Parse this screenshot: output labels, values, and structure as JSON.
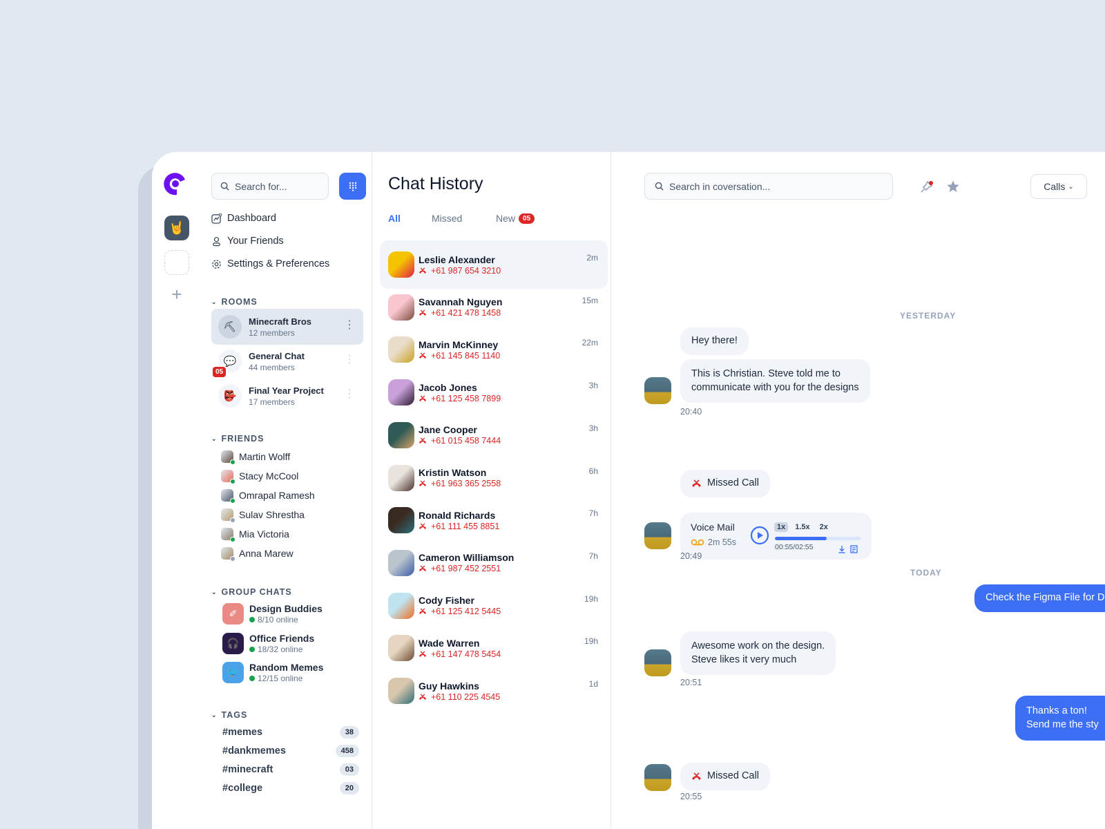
{
  "rail": {
    "emoji": "🤘",
    "add_label": "+"
  },
  "nav": {
    "search_placeholder": "Search for...",
    "menu": [
      {
        "label": "Dashboard",
        "icon": "dashboard-icon"
      },
      {
        "label": "Your Friends",
        "icon": "user-icon"
      },
      {
        "label": "Settings & Preferences",
        "icon": "gear-icon"
      }
    ],
    "rooms_title": "ROOMS",
    "rooms": [
      {
        "name": "Minecraft Bros",
        "members": "12 members",
        "icon": "⛏",
        "active": true
      },
      {
        "name": "General Chat",
        "members": "44 members",
        "icon": "💬",
        "badge": "05"
      },
      {
        "name": "Final Year Project",
        "members": "17 members",
        "icon": "👺"
      }
    ],
    "friends_title": "FRIENDS",
    "friends": [
      {
        "name": "Martin Wolff",
        "status": "online"
      },
      {
        "name": "Stacy McCool",
        "status": "online"
      },
      {
        "name": "Omrapal Ramesh",
        "status": "online"
      },
      {
        "name": "Sulav Shrestha",
        "status": "offline"
      },
      {
        "name": "Mia Victoria",
        "status": "online"
      },
      {
        "name": "Anna Marew",
        "status": "offline"
      }
    ],
    "groups_title": "GROUP CHATS",
    "groups": [
      {
        "name": "Design Buddies",
        "online": "8/10 online",
        "color": "#ea8a85",
        "icon": "brush-icon"
      },
      {
        "name": "Office Friends",
        "online": "18/32 online",
        "color": "#2a1c4a",
        "icon": "headphones-icon"
      },
      {
        "name": "Random Memes",
        "online": "12/15 online",
        "color": "#4aa3e8",
        "icon": "bird-icon"
      }
    ],
    "tags_title": "TAGS",
    "tags": [
      {
        "name": "#memes",
        "count": "38"
      },
      {
        "name": "#dankmemes",
        "count": "458"
      },
      {
        "name": "#minecraft",
        "count": "03"
      },
      {
        "name": "#college",
        "count": "20"
      }
    ]
  },
  "history": {
    "title": "Chat History",
    "tabs": [
      {
        "label": "All",
        "active": true
      },
      {
        "label": "Missed"
      },
      {
        "label": "New",
        "badge": "05"
      }
    ],
    "chats": [
      {
        "name": "Leslie Alexander",
        "phone": "+61 987 654 3210",
        "time": "2m",
        "active": true,
        "avatar": [
          "#f5c400",
          "#e11d48"
        ]
      },
      {
        "name": "Savannah Nguyen",
        "phone": "+61 421 478 1458",
        "time": "15m",
        "avatar": [
          "#f9c6d0",
          "#7a4a3a"
        ]
      },
      {
        "name": "Marvin McKinney",
        "phone": "+61 145 845 1140",
        "time": "22m",
        "avatar": [
          "#e9dcc8",
          "#c8a020"
        ]
      },
      {
        "name": "Jacob Jones",
        "phone": "+61 125 458 7899",
        "time": "3h",
        "avatar": [
          "#c9a0d9",
          "#2b1a2e"
        ]
      },
      {
        "name": "Jane Cooper",
        "phone": "+61 015 458 7444",
        "time": "3h",
        "avatar": [
          "#2f5a55",
          "#d9a46a"
        ]
      },
      {
        "name": "Kristin Watson",
        "phone": "+61 963 365 2558",
        "time": "6h",
        "avatar": [
          "#e8e3dd",
          "#4a2f28"
        ]
      },
      {
        "name": "Ronald Richards",
        "phone": "+61 111 455 8851",
        "time": "7h",
        "avatar": [
          "#3a2b22",
          "#2d6f7a"
        ]
      },
      {
        "name": "Cameron Williamson",
        "phone": "+61 987 452 2551",
        "time": "7h",
        "avatar": [
          "#b9c4cc",
          "#3a5aa8"
        ]
      },
      {
        "name": "Cody Fisher",
        "phone": "+61 125 412 5445",
        "time": "19h",
        "avatar": [
          "#bfe3ef",
          "#f06a1d"
        ]
      },
      {
        "name": "Wade Warren",
        "phone": "+61 147 478 5454",
        "time": "19h",
        "avatar": [
          "#e6d6c1",
          "#6d4a32"
        ]
      },
      {
        "name": "Guy Hawkins",
        "phone": "+61 110 225 4545",
        "time": "1d",
        "avatar": [
          "#d9c7ad",
          "#2e6b76"
        ]
      }
    ]
  },
  "conversation": {
    "search_placeholder": "Search in coversation...",
    "calls_label": "Calls",
    "yesterday_label": "YESTERDAY",
    "today_label": "TODAY",
    "messages": {
      "m1": "Hey there!",
      "m2_line1": "This is Christian. Steve told me to",
      "m2_line2": "communicate with you for the designs",
      "m2_time": "20:40",
      "missed1": "Missed Call",
      "vm_time_stamp": "20:49",
      "sent1": "Check the Figma File for D",
      "m3_line1": "Awesome work on the design.",
      "m3_line2": "Steve likes it very much",
      "m3_time": "20:51",
      "sent2_line1": "Thanks a ton!",
      "sent2_line2": "Send me the sty",
      "missed2": "Missed Call",
      "missed2_time": "20:55"
    },
    "voicemail": {
      "title": "Voice Mail",
      "duration": "2m 55s",
      "speeds": [
        "1x",
        "1.5x",
        "2x"
      ],
      "active_speed": "1x",
      "position": "00:55/02:55",
      "progress": 0.6
    }
  }
}
